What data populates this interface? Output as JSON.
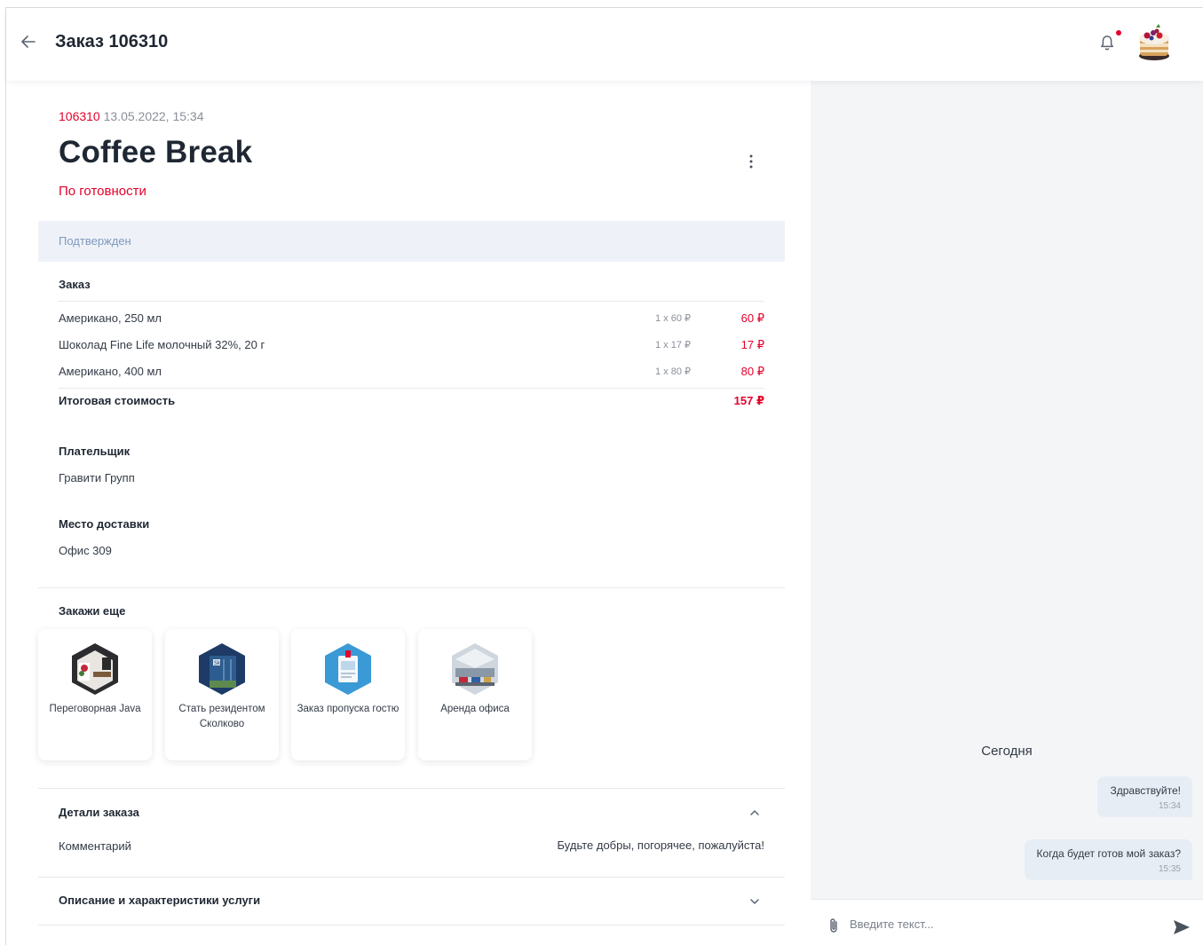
{
  "header": {
    "title": "Заказ 106310",
    "back_icon": "arrow-left-icon",
    "notifications_icon": "bell-icon",
    "colors": {
      "accent": "#e4002b",
      "status_text": "#7f98bd",
      "status_bg": "#eef2f8"
    }
  },
  "order": {
    "number": "106310",
    "datetime": "13.05.2022, 15:34",
    "title": "Coffee Break",
    "subtitle": "По готовности",
    "status": "Подтвержден"
  },
  "order_items": {
    "heading": "Заказ",
    "items": [
      {
        "name": "Американо, 250 мл",
        "qty": "1 x 60 ₽",
        "price": "60 ₽"
      },
      {
        "name": "Шоколад Fine Life молочный 32%, 20 г",
        "qty": "1 x 17 ₽",
        "price": "17 ₽"
      },
      {
        "name": "Американо, 400 мл",
        "qty": "1 x 80 ₽",
        "price": "80 ₽"
      }
    ],
    "total_label": "Итоговая стоимость",
    "total_value": "157 ₽"
  },
  "payer": {
    "heading": "Плательщик",
    "value": "Гравити Групп"
  },
  "delivery": {
    "heading": "Место доставки",
    "value": "Офис 309"
  },
  "order_more": {
    "heading": "Закажи еще",
    "cards": [
      {
        "label": "Переговорная Java",
        "icon": "meeting-room-icon"
      },
      {
        "label": "Стать резидентом Сколково",
        "icon": "skolkovo-building-icon"
      },
      {
        "label": "Заказ пропуска гостю",
        "icon": "guest-pass-icon"
      },
      {
        "label": "Аренда офиса",
        "icon": "office-rent-icon"
      }
    ]
  },
  "details": {
    "heading": "Детали заказа",
    "comment_label": "Комментарий",
    "comment_value": "Будьте добры, погорячее, пожалуйста!"
  },
  "description": {
    "heading": "Описание и характеристики услуги"
  },
  "chat": {
    "day_label": "Сегодня",
    "messages": [
      {
        "text": "Здравствуйте!",
        "time": "15:34"
      },
      {
        "text": "Когда будет готов мой заказ?",
        "time": "15:35"
      }
    ],
    "input_placeholder": "Введите текст...",
    "attach_icon": "paperclip-icon",
    "send_icon": "send-icon"
  }
}
